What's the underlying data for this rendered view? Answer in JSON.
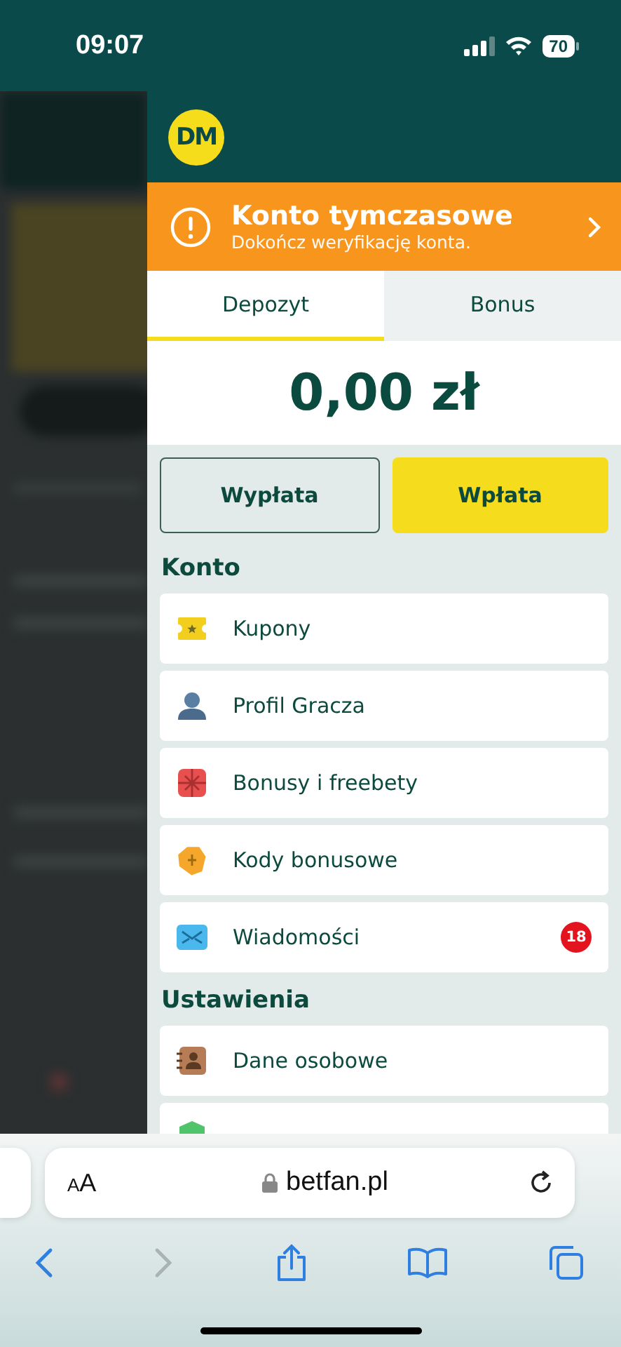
{
  "status_bar": {
    "time": "09:07",
    "battery": "70"
  },
  "drawer": {
    "avatar": "DM",
    "banner": {
      "title": "Konto tymczasowe",
      "subtitle": "Dokończ weryfikację konta."
    },
    "tabs": [
      {
        "label": "Depozyt",
        "selected": true
      },
      {
        "label": "Bonus",
        "selected": false
      }
    ],
    "balance": "0,00 zł",
    "buttons": [
      {
        "label": "Wypłata",
        "kind": "outline"
      },
      {
        "label": "Wpłata",
        "kind": "primary"
      }
    ],
    "sections": [
      {
        "title": "Konto",
        "items": [
          {
            "label": "Kupony"
          },
          {
            "label": "Profil Gracza"
          },
          {
            "label": "Bonusy i freebety"
          },
          {
            "label": "Kody bonusowe"
          },
          {
            "label": "Wiadomości",
            "badge": "18"
          }
        ]
      },
      {
        "title": "Ustawienia",
        "items": [
          {
            "label": "Dane osobowe"
          },
          {
            "kind": "cut"
          }
        ]
      }
    ]
  },
  "browser": {
    "text_size": "AA",
    "url": "betfan.pl"
  }
}
